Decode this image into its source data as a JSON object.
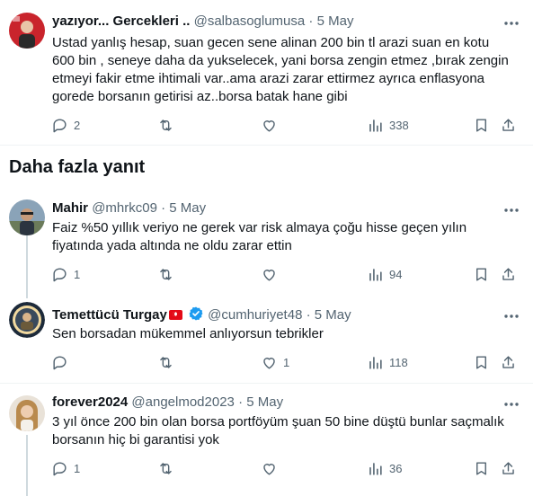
{
  "tweets": [
    {
      "name": "yazıyor... Gercekleri ..",
      "handle": "@salbasoglumusa",
      "dot": "·",
      "date": "5 May",
      "text": "Ustad yanlış hesap, suan gecen sene alinan 200 bin tl arazi suan en kotu 600 bin , seneye daha da yukselecek, yani borsa zengin etmez ,bırak zengin etmeyi fakir etme ihtimali var..ama arazi zarar ettirmez ayrıca enflasyona gorede borsanın getirisi az..borsa batak hane gibi",
      "replies": "2",
      "retweets": "",
      "likes": "",
      "views": "338"
    },
    {
      "name": "Mahir",
      "handle": "@mhrkc09",
      "dot": "·",
      "date": "5 May",
      "text": "Faiz %50 yıllık veriyo ne gerek var risk almaya  çoğu hisse geçen yılın fiyatında yada altında ne oldu zarar ettin",
      "replies": "1",
      "retweets": "",
      "likes": "",
      "views": "94"
    },
    {
      "name": "Temettücü Turgay",
      "handle": "@cumhuriyet48",
      "dot": "·",
      "date": "5 May",
      "text": "Sen borsadan mükemmel anlıyorsun tebrikler",
      "replies": "",
      "retweets": "",
      "likes": "1",
      "views": "118"
    },
    {
      "name": "forever2024",
      "handle": "@angelmod2023",
      "dot": "·",
      "date": "5 May",
      "text": "3 yıl önce 200 bin olan borsa portföyüm şuan 50 bine düştü bunlar saçmalık borsanın hiç bi garantisi yok",
      "replies": "1",
      "retweets": "",
      "likes": "",
      "views": "36"
    }
  ],
  "section_title": "Daha fazla yanıt",
  "colors": {
    "text": "#0f1419",
    "muted": "#536471",
    "verified": "#1d9bf0",
    "flag": "#e30a17"
  }
}
